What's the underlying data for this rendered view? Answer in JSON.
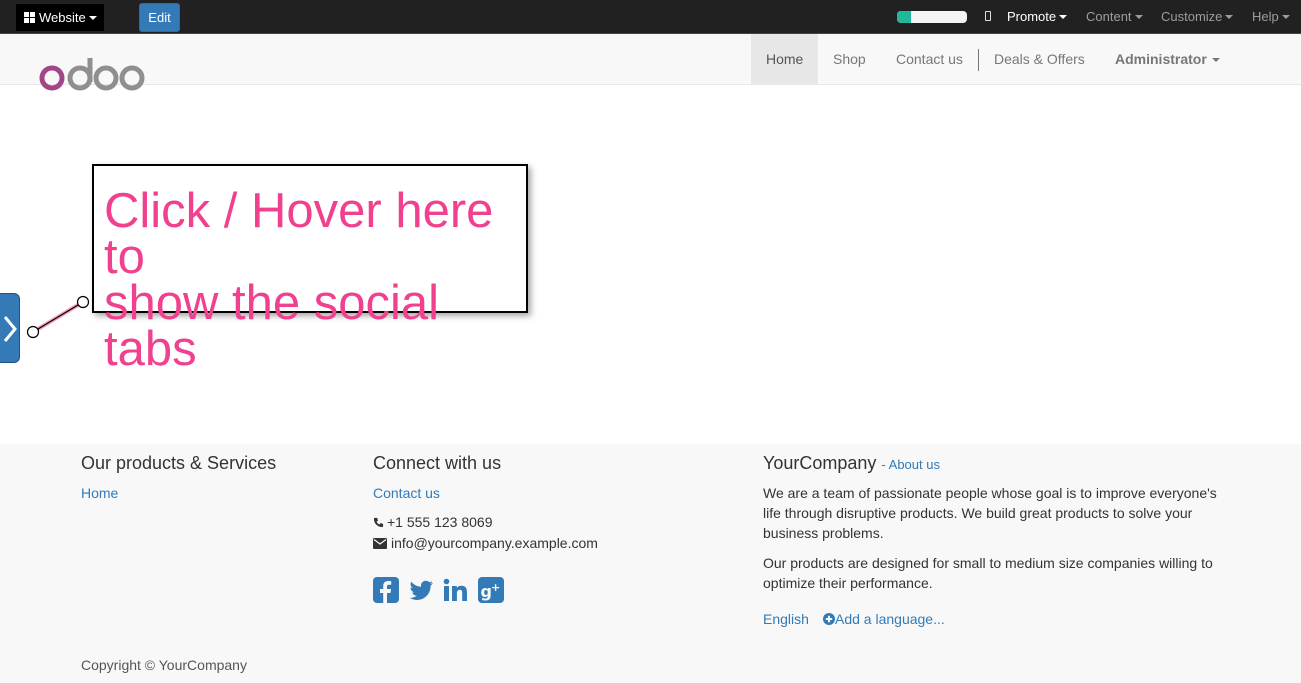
{
  "adminbar": {
    "website_label": "Website",
    "edit_label": "Edit",
    "progress": 0.2,
    "menus": {
      "promote": "Promote",
      "content": "Content",
      "customize": "Customize",
      "help": "Help"
    }
  },
  "header": {
    "logo_text": "odoo",
    "nav": [
      {
        "label": "Home",
        "active": true
      },
      {
        "label": "Shop"
      },
      {
        "label": "Contact us"
      },
      {
        "label": "Deals & Offers"
      },
      {
        "label": "Administrator"
      }
    ]
  },
  "social_tab": {
    "tour_text_line1": "Click / Hover here to",
    "tour_text_line2": "show the social tabs"
  },
  "footer": {
    "col1": {
      "heading": "Our products & Services",
      "link": "Home"
    },
    "col2": {
      "heading": "Connect with us",
      "link": "Contact us",
      "phone": "+1 555 123 8069",
      "email": "info@yourcompany.example.com",
      "social": [
        "facebook-icon",
        "twitter-icon",
        "linkedin-icon",
        "google-plus-icon"
      ]
    },
    "col3": {
      "heading": "YourCompany",
      "about_link": "- About us",
      "para1": "We are a team of passionate people whose goal is to improve everyone's life through disruptive products. We build great products to solve your business problems.",
      "para2": "Our products are designed for small to medium size companies willing to optimize their performance.",
      "language": "English",
      "add_language": "Add a language..."
    },
    "copyright": "Copyright © YourCompany"
  },
  "colors": {
    "accent": "#337ab7",
    "tour_text": "#f0418f",
    "admin_bar": "#212121",
    "logo_purple": "#a24689",
    "logo_grey": "#8f8f8f"
  }
}
